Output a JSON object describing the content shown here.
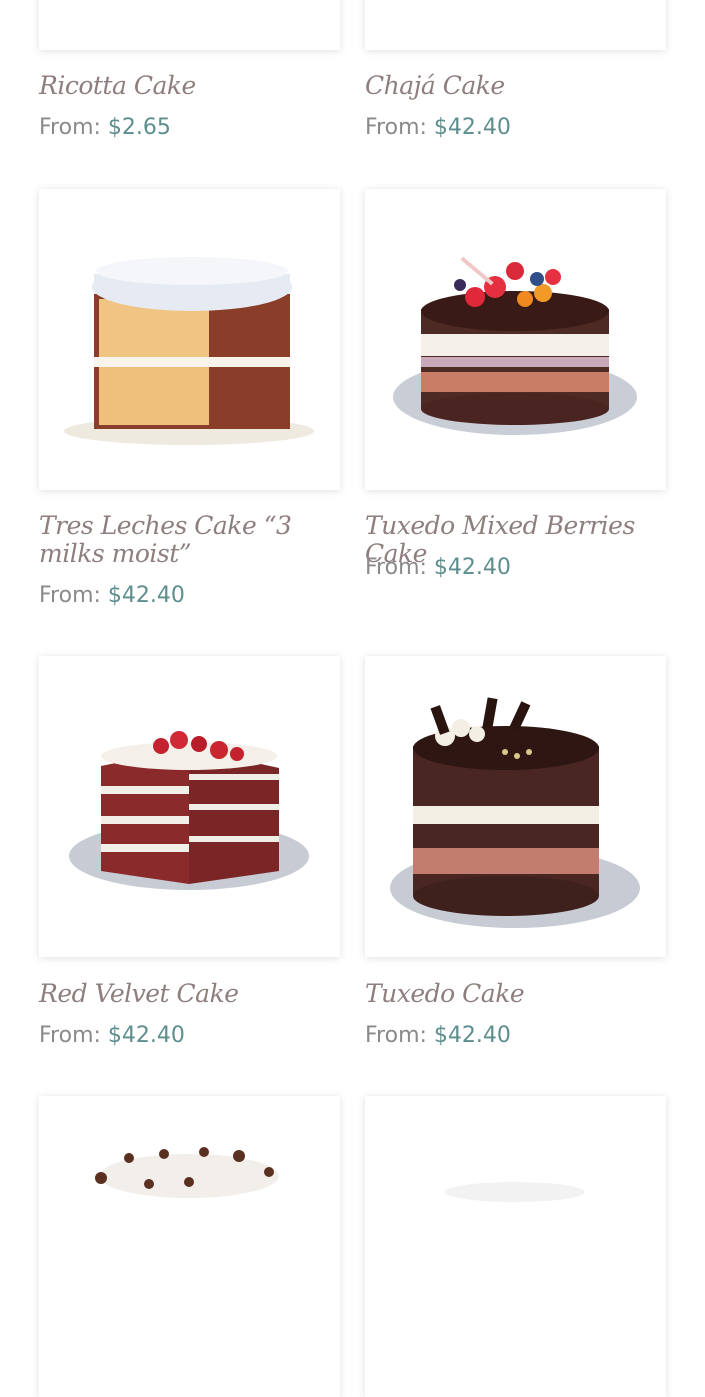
{
  "accent": "#5e8e8e",
  "title_color": "#8e7e7e",
  "products": [
    {
      "name": "Ricotta Cake",
      "from": "From:",
      "price": "$2.65"
    },
    {
      "name": "Chajá Cake",
      "from": "From:",
      "price": "$42.40"
    },
    {
      "name": "Tres Leches Cake “3 milks moist”",
      "from": "From:",
      "price": "$42.40"
    },
    {
      "name": "Tuxedo Mixed Berries Cake",
      "from": "From:",
      "price": "$42.40"
    },
    {
      "name": "Red Velvet Cake",
      "from": "From:",
      "price": "$42.40"
    },
    {
      "name": "Tuxedo Cake",
      "from": "From:",
      "price": "$42.40"
    }
  ]
}
